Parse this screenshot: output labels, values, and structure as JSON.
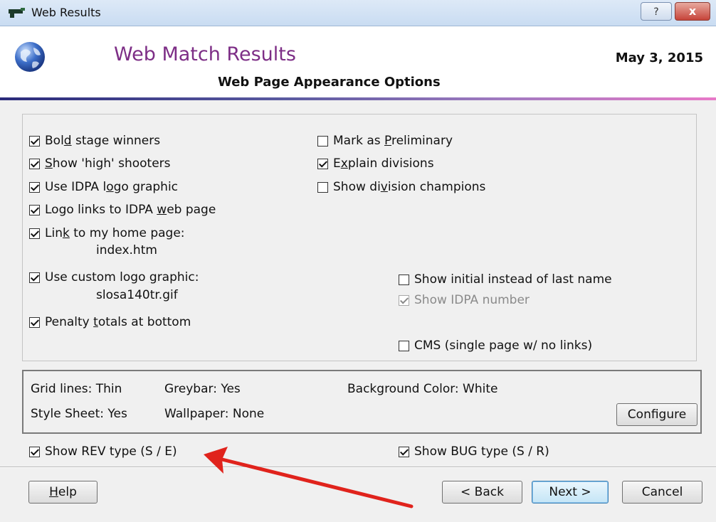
{
  "window": {
    "title": "Web Results",
    "help_caption": "?",
    "close_caption": "x"
  },
  "header": {
    "app_title": "Web Match Results",
    "subtitle": "Web Page Appearance Options",
    "date": "May  3, 2015"
  },
  "options": {
    "bold_stage_winners": {
      "pre": "Bol",
      "ul": "d",
      "post": " stage winners",
      "checked": true
    },
    "show_high_shooters": {
      "pre": "",
      "ul": "S",
      "post": "how  'high' shooters",
      "checked": true
    },
    "use_idpa_logo": {
      "pre": "Use IDPA l",
      "ul": "o",
      "post": "go graphic",
      "checked": true
    },
    "logo_links": {
      "pre": "Logo links to IDPA ",
      "ul": "w",
      "post": "eb page",
      "checked": true
    },
    "link_home": {
      "pre": "Lin",
      "ul": "k",
      "post": " to my home page:",
      "checked": true,
      "value": "index.htm"
    },
    "custom_logo": {
      "pre": "Use custom logo ",
      "ul": "g",
      "post": "raphic:",
      "checked": true,
      "value": "slosa140tr.gif"
    },
    "penalty_totals": {
      "pre": "Penalty ",
      "ul": "t",
      "post": "otals at bottom",
      "checked": true
    },
    "mark_preliminary": {
      "pre": "Mark as ",
      "ul": "P",
      "post": "reliminary",
      "checked": false
    },
    "explain_divisions": {
      "pre": "E",
      "ul": "x",
      "post": "plain divisions",
      "checked": true
    },
    "division_champions": {
      "pre": "Show di",
      "ul": "v",
      "post": "ision champions",
      "checked": false
    },
    "show_initial": {
      "label": "Show initial instead of last name",
      "checked": false
    },
    "show_idpa_number": {
      "label": "Show IDPA number",
      "checked": true,
      "disabled": true
    },
    "cms": {
      "label": "CMS (single page w/ no links)",
      "checked": false
    }
  },
  "summary": {
    "grid_lines": "Grid lines: Thin",
    "greybar": "Greybar:  Yes",
    "background_color": "Background Color:  White",
    "style_sheet": "Style Sheet: Yes",
    "wallpaper": "Wallpaper:  None",
    "configure_label": "Configure"
  },
  "extras": {
    "show_rev_type": {
      "label": "Show REV type (S / E)",
      "checked": true
    },
    "show_bug_type": {
      "label": "Show BUG type (S / R)",
      "checked": true
    }
  },
  "footer": {
    "help": {
      "pre": "",
      "ul": "H",
      "post": "elp"
    },
    "back": "< Back",
    "next": "Next >",
    "cancel": "Cancel"
  },
  "colors": {
    "title_purple": "#7d2e86",
    "annotation_arrow": "#e0231c"
  }
}
